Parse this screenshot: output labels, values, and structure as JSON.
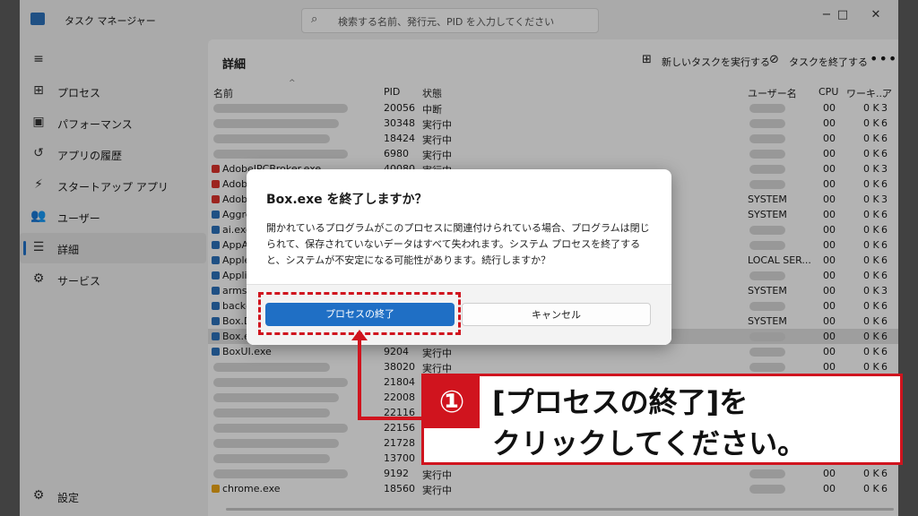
{
  "window": {
    "title": "タスク マネージャー",
    "search_placeholder": "検索する名前、発行元、PID を入力してください",
    "minimize_icon": "−",
    "maximize_icon": "□",
    "close_icon": "✕"
  },
  "sidebar": {
    "menu_icon": "≡",
    "items": [
      {
        "label": "プロセス",
        "icon": "⊞"
      },
      {
        "label": "パフォーマンス",
        "icon": "▣"
      },
      {
        "label": "アプリの履歴",
        "icon": "↺"
      },
      {
        "label": "スタートアップ アプリ",
        "icon": "⚡"
      },
      {
        "label": "ユーザー",
        "icon": "👥"
      },
      {
        "label": "詳細",
        "icon": "☰"
      },
      {
        "label": "サービス",
        "icon": "⚙"
      }
    ],
    "settings_label": "設定",
    "settings_icon": "⚙"
  },
  "main": {
    "title": "詳細",
    "toolbar": {
      "new_task": "新しいタスクを実行する",
      "end_task": "タスクを終了する",
      "more": "•••"
    },
    "columns": {
      "name": "名前",
      "pid": "PID",
      "status": "状態",
      "user": "ユーザー名",
      "cpu": "CPU",
      "memory": "ワーキ...",
      "extra": "ア"
    },
    "rows": [
      {
        "name": "",
        "pid": "20056",
        "status": "中断",
        "user": "",
        "cpu": "00",
        "mem": "0 K",
        "x": "3"
      },
      {
        "name": "",
        "pid": "30348",
        "status": "実行中",
        "user": "",
        "cpu": "00",
        "mem": "0 K",
        "x": "6"
      },
      {
        "name": "",
        "pid": "18424",
        "status": "実行中",
        "user": "",
        "cpu": "00",
        "mem": "0 K",
        "x": "6"
      },
      {
        "name": "",
        "pid": "6980",
        "status": "実行中",
        "user": "",
        "cpu": "00",
        "mem": "0 K",
        "x": "6"
      },
      {
        "name": "AdobeIPCBroker.exe",
        "pid": "40080",
        "status": "実行中",
        "user": "",
        "cpu": "00",
        "mem": "0 K",
        "x": "3"
      },
      {
        "name": "Adobe",
        "pid": "",
        "status": "",
        "user": "",
        "cpu": "00",
        "mem": "0 K",
        "x": "6"
      },
      {
        "name": "Adob",
        "pid": "",
        "status": "",
        "user": "SYSTEM",
        "cpu": "00",
        "mem": "0 K",
        "x": "3"
      },
      {
        "name": "Aggre",
        "pid": "",
        "status": "",
        "user": "SYSTEM",
        "cpu": "00",
        "mem": "0 K",
        "x": "6"
      },
      {
        "name": "ai.exe",
        "pid": "",
        "status": "",
        "user": "",
        "cpu": "00",
        "mem": "0 K",
        "x": "6"
      },
      {
        "name": "AppA",
        "pid": "",
        "status": "",
        "user": "",
        "cpu": "00",
        "mem": "0 K",
        "x": "6"
      },
      {
        "name": "Apple",
        "pid": "",
        "status": "",
        "user": "LOCAL SER...",
        "cpu": "00",
        "mem": "0 K",
        "x": "6"
      },
      {
        "name": "Applic",
        "pid": "",
        "status": "",
        "user": "",
        "cpu": "00",
        "mem": "0 K",
        "x": "6"
      },
      {
        "name": "armsv",
        "pid": "",
        "status": "",
        "user": "SYSTEM",
        "cpu": "00",
        "mem": "0 K",
        "x": "3"
      },
      {
        "name": "backg",
        "pid": "",
        "status": "",
        "user": "",
        "cpu": "00",
        "mem": "0 K",
        "x": "6"
      },
      {
        "name": "Box.D",
        "pid": "",
        "status": "",
        "user": "SYSTEM",
        "cpu": "00",
        "mem": "0 K",
        "x": "6"
      },
      {
        "name": "Box.e",
        "pid": "",
        "status": "",
        "user": "",
        "cpu": "00",
        "mem": "0 K",
        "x": "6"
      },
      {
        "name": "BoxUI.exe",
        "pid": "9204",
        "status": "実行中",
        "user": "",
        "cpu": "00",
        "mem": "0 K",
        "x": "6"
      },
      {
        "name": "",
        "pid": "38020",
        "status": "実行中",
        "user": "",
        "cpu": "00",
        "mem": "0 K",
        "x": "6"
      },
      {
        "name": "",
        "pid": "21804",
        "status": "",
        "user": "",
        "cpu": "",
        "mem": "",
        "x": ""
      },
      {
        "name": "",
        "pid": "22008",
        "status": "",
        "user": "",
        "cpu": "",
        "mem": "",
        "x": ""
      },
      {
        "name": "",
        "pid": "22116",
        "status": "",
        "user": "",
        "cpu": "",
        "mem": "",
        "x": ""
      },
      {
        "name": "",
        "pid": "22156",
        "status": "",
        "user": "",
        "cpu": "",
        "mem": "",
        "x": ""
      },
      {
        "name": "",
        "pid": "21728",
        "status": "",
        "user": "",
        "cpu": "",
        "mem": "",
        "x": ""
      },
      {
        "name": "",
        "pid": "13700",
        "status": "",
        "user": "",
        "cpu": "",
        "mem": "",
        "x": ""
      },
      {
        "name": "",
        "pid": "9192",
        "status": "実行中",
        "user": "",
        "cpu": "00",
        "mem": "0 K",
        "x": "6"
      },
      {
        "name": "chrome.exe",
        "pid": "18560",
        "status": "実行中",
        "user": "",
        "cpu": "00",
        "mem": "0 K",
        "x": "6"
      }
    ]
  },
  "dialog": {
    "title": "Box.exe を終了しますか？",
    "message": "開かれているプログラムがこのプロセスに関連付けられている場合、プログラムは閉じられて、保存されていないデータはすべて失われます。システム プロセスを終了すると、システムが不安定になる可能性があります。続行しますか？",
    "confirm": "プロセスの終了",
    "cancel": "キャンセル"
  },
  "callout": {
    "badge": "①",
    "line1": "[プロセスの終了]を",
    "line2": "クリックしてください。"
  },
  "colors": {
    "accent": "#1f6fc5",
    "annotation": "#d0141e"
  }
}
